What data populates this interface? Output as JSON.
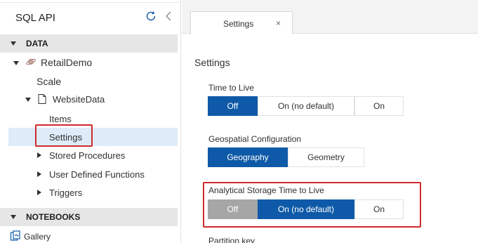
{
  "sidebar": {
    "title": "SQL API",
    "sections": [
      {
        "label": "DATA"
      },
      {
        "label": "NOTEBOOKS"
      }
    ],
    "database": "RetailDemo",
    "scale": "Scale",
    "container": "WebsiteData",
    "items": [
      {
        "label": "Items"
      },
      {
        "label": "Settings"
      },
      {
        "label": "Stored Procedures"
      },
      {
        "label": "User Defined Functions"
      },
      {
        "label": "Triggers"
      }
    ],
    "gallery": "Gallery"
  },
  "tab": {
    "label": "Settings",
    "close": "×"
  },
  "settings": {
    "title": "Settings",
    "ttl": {
      "label": "Time to Live",
      "options": [
        "Off",
        "On (no default)",
        "On"
      ],
      "selected": "Off"
    },
    "geo": {
      "label": "Geospatial Configuration",
      "options": [
        "Geography",
        "Geometry"
      ],
      "selected": "Geography"
    },
    "ast": {
      "label": "Analytical Storage Time to Live",
      "options": [
        "Off",
        "On (no default)",
        "On"
      ],
      "selected": "On (no default)",
      "disabled": "Off"
    },
    "partition": {
      "label": "Partition key"
    }
  },
  "colors": {
    "accent": "#0f5aa8",
    "highlight": "#cf2a2a",
    "selection": "#ddecf8"
  }
}
